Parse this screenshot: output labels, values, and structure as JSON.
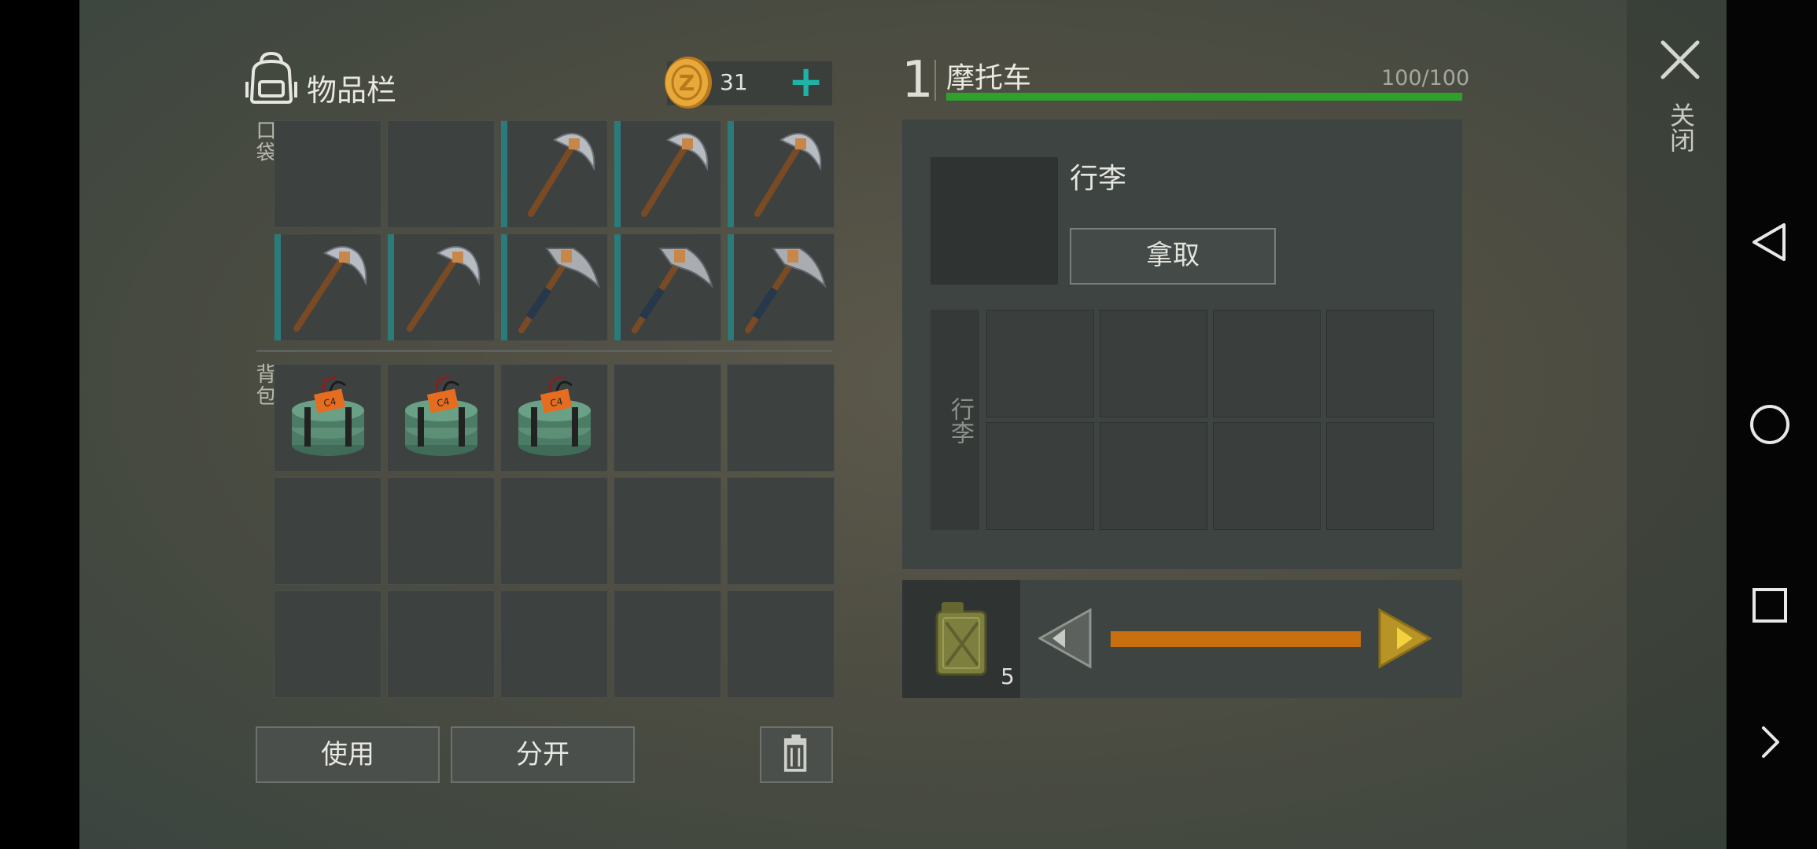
{
  "inventory": {
    "title": "物品栏",
    "pocket_label": "口袋",
    "backpack_label": "背包",
    "coins": "31"
  },
  "pocket_slots": [
    {
      "item": "empty"
    },
    {
      "item": "empty"
    },
    {
      "item": "pickaxe-icon"
    },
    {
      "item": "pickaxe-icon"
    },
    {
      "item": "pickaxe-icon"
    },
    {
      "item": "pickaxe-icon"
    },
    {
      "item": "pickaxe-icon"
    },
    {
      "item": "hammer-axe-icon"
    },
    {
      "item": "hammer-axe-icon"
    },
    {
      "item": "hammer-axe-icon"
    }
  ],
  "backpack_slots": [
    {
      "item": "c4-explosive-icon"
    },
    {
      "item": "c4-explosive-icon"
    },
    {
      "item": "c4-explosive-icon"
    },
    {
      "item": "empty"
    },
    {
      "item": "empty"
    },
    {
      "item": "empty"
    },
    {
      "item": "empty"
    },
    {
      "item": "empty"
    },
    {
      "item": "empty"
    },
    {
      "item": "empty"
    },
    {
      "item": "empty"
    },
    {
      "item": "empty"
    },
    {
      "item": "empty"
    },
    {
      "item": "empty"
    },
    {
      "item": "empty"
    }
  ],
  "buttons": {
    "use": "使用",
    "split": "分开"
  },
  "vehicle": {
    "number": "1",
    "name": "摩托车",
    "durability": "100/100",
    "durability_fraction": 1.0
  },
  "luggage": {
    "title": "行李",
    "take": "拿取",
    "side_label": "行李"
  },
  "fuel": {
    "count": "5",
    "level_fraction": 1.0
  },
  "close_label": "关闭",
  "colors": {
    "accent_teal": "#2b7b7a",
    "hp_green": "#2ea12c",
    "fuel_orange": "#c8700f",
    "plus_teal": "#1fb2a6"
  }
}
